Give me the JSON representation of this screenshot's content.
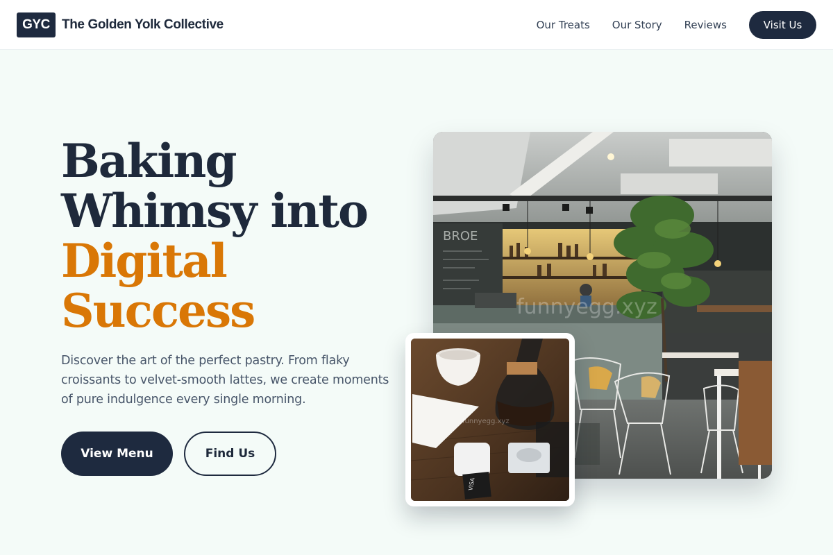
{
  "header": {
    "logo_text": "GYC",
    "brand_name": "The Golden Yolk Collective",
    "nav": [
      "Our Treats",
      "Our Story",
      "Reviews"
    ],
    "cta_label": "Visit Us"
  },
  "hero": {
    "title_lines": [
      "Baking",
      "Whimsy into"
    ],
    "title_accent_lines": [
      "Digital",
      "Success"
    ],
    "description": "Discover the art of the perfect pastry. From flaky croissants to velvet-smooth lattes, we create moments of pure indulgence every single morning.",
    "primary_button": "View Menu",
    "secondary_button": "Find Us"
  },
  "images": {
    "cafe_watermark": "funnyegg.xyz",
    "coffee_watermark": "funnyegg.xyz"
  },
  "colors": {
    "background": "#f4fbf8",
    "navy": "#1e2a3f",
    "accent": "#d97706",
    "body_text": "#475569"
  }
}
